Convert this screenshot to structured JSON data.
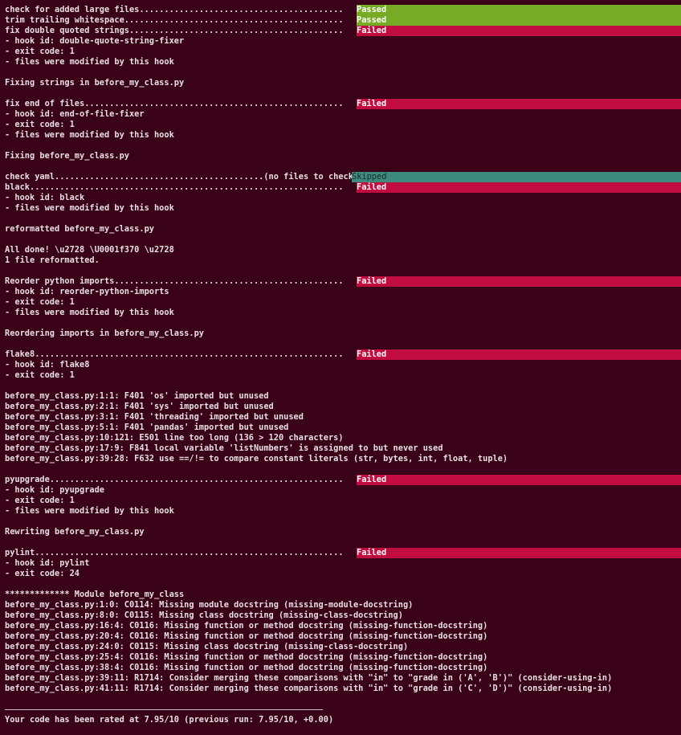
{
  "terminal": {
    "colors": {
      "background": "#3a0218",
      "text": "#e8e0e2",
      "passed": "#76ab23",
      "failed": "#c00c3f",
      "skipped": "#3d8a7e"
    },
    "hooks": [
      {
        "name": "check for added large files.........................................",
        "status": "Passed"
      },
      {
        "name": "trim trailing whitespace............................................",
        "status": "Passed"
      },
      {
        "name": "fix double quoted strings...........................................",
        "status": "Failed",
        "details": [
          "- hook id: double-quote-string-fixer",
          "- exit code: 1",
          "- files were modified by this hook"
        ],
        "output": [
          "Fixing strings in before_my_class.py"
        ]
      },
      {
        "name": "fix end of files....................................................",
        "status": "Failed",
        "details": [
          "- hook id: end-of-file-fixer",
          "- exit code: 1",
          "- files were modified by this hook"
        ],
        "output": [
          "Fixing before_my_class.py"
        ]
      },
      {
        "name": "check yaml..........................................(no files to check)",
        "status": "Skipped"
      },
      {
        "name": "black...............................................................",
        "status": "Failed",
        "details": [
          "- hook id: black",
          "- files were modified by this hook"
        ],
        "output": [
          "reformatted before_my_class.py",
          "",
          "All done! \\u2728 \\U0001f370 \\u2728",
          "1 file reformatted."
        ]
      },
      {
        "name": "Reorder python imports..............................................",
        "status": "Failed",
        "details": [
          "- hook id: reorder-python-imports",
          "- exit code: 1",
          "- files were modified by this hook"
        ],
        "output": [
          "Reordering imports in before_my_class.py"
        ]
      },
      {
        "name": "flake8..............................................................",
        "status": "Failed",
        "details": [
          "- hook id: flake8",
          "- exit code: 1"
        ],
        "output": [
          "before_my_class.py:1:1: F401 'os' imported but unused",
          "before_my_class.py:2:1: F401 'sys' imported but unused",
          "before_my_class.py:3:1: F401 'threading' imported but unused",
          "before_my_class.py:5:1: F401 'pandas' imported but unused",
          "before_my_class.py:10:121: E501 line too long (136 > 120 characters)",
          "before_my_class.py:17:9: F841 local variable 'listNumbers' is assigned to but never used",
          "before_my_class.py:39:28: F632 use ==/!= to compare constant literals (str, bytes, int, float, tuple)"
        ]
      },
      {
        "name": "pyupgrade...........................................................",
        "status": "Failed",
        "details": [
          "- hook id: pyupgrade",
          "- exit code: 1",
          "- files were modified by this hook"
        ],
        "output": [
          "Rewriting before_my_class.py"
        ]
      },
      {
        "name": "pylint..............................................................",
        "status": "Failed",
        "details": [
          "- hook id: pylint",
          "- exit code: 24"
        ],
        "output": [
          "************* Module before_my_class",
          "before_my_class.py:1:0: C0114: Missing module docstring (missing-module-docstring)",
          "before_my_class.py:8:0: C0115: Missing class docstring (missing-class-docstring)",
          "before_my_class.py:16:4: C0116: Missing function or method docstring (missing-function-docstring)",
          "before_my_class.py:20:4: C0116: Missing function or method docstring (missing-function-docstring)",
          "before_my_class.py:24:0: C0115: Missing class docstring (missing-class-docstring)",
          "before_my_class.py:25:4: C0116: Missing function or method docstring (missing-function-docstring)",
          "before_my_class.py:38:4: C0116: Missing function or method docstring (missing-function-docstring)",
          "before_my_class.py:39:11: R1714: Consider merging these comparisons with \"in\" to \"grade in ('A', 'B')\" (consider-using-in)",
          "before_my_class.py:41:11: R1714: Consider merging these comparisons with \"in\" to \"grade in ('C', 'D')\" (consider-using-in)"
        ],
        "rating": "Your code has been rated at 7.95/10 (previous run: 7.95/10, +0.00)"
      }
    ]
  }
}
